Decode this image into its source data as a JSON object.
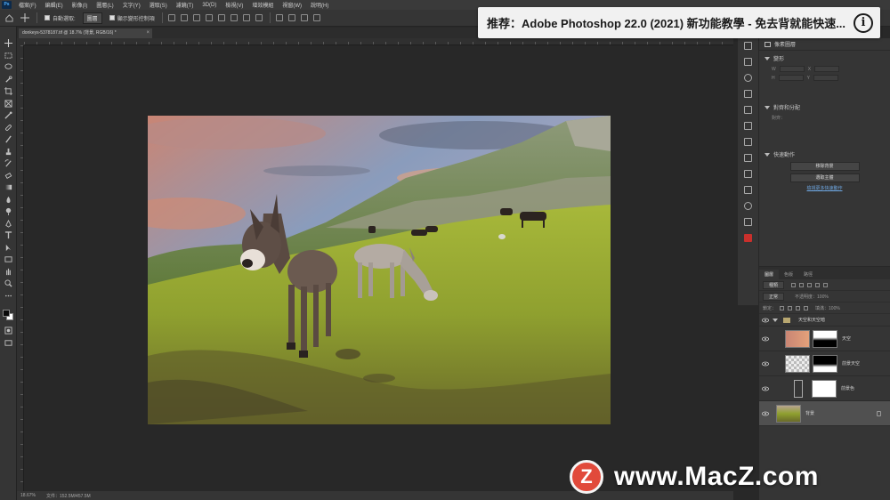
{
  "app": {
    "logo_text": "Ps",
    "menu": [
      "檔案(F)",
      "編輯(E)",
      "影像(I)",
      "圖層(L)",
      "文字(Y)",
      "選取(S)",
      "濾鏡(T)",
      "3D(D)",
      "檢視(V)",
      "增效模組",
      "視窗(W)",
      "說明(H)"
    ]
  },
  "options_bar": {
    "auto_select_label": "自動選取:",
    "auto_select_target": "圖層",
    "show_transform_label": "顯示變形控制項"
  },
  "banner": {
    "text": "推荐：Adobe Photoshop 22.0 (2021) 新功能教學 - 免去背就能快速...",
    "info_icon": "i"
  },
  "document": {
    "tab_title": "donkeys-5378187.tif @ 18.7% (背景, RGB/16) *",
    "tab_close": "×"
  },
  "status_bar": {
    "zoom": "18.67%",
    "doc_info": "文件：152.5M/457.5M"
  },
  "properties": {
    "title": "屬性",
    "header_label": "像素圖層",
    "transform_title": "變形",
    "w_label": "W",
    "h_label": "H",
    "x_label": "X",
    "y_label": "Y",
    "align_title": "對齊和分配",
    "align_sub": "對齊：",
    "quick_actions_title": "快速動作",
    "btn_remove_bg": "移除背景",
    "btn_select_subject": "選取主體",
    "link_more": "檢視更多快速動作"
  },
  "layers": {
    "tabs": [
      "圖層",
      "色版",
      "路徑"
    ],
    "kind_label": "種類",
    "mode_label": "正常",
    "opacity_label": "不透明度：100%",
    "lock_label": "鎖定：",
    "fill_label": "填滿：100%",
    "items": [
      {
        "name": "天空和天空暗",
        "type": "group"
      },
      {
        "name": "天空",
        "type": "layer"
      },
      {
        "name": "前景天空",
        "type": "layer"
      },
      {
        "name": "前景色",
        "type": "layer"
      },
      {
        "name": "背景",
        "type": "background"
      }
    ]
  },
  "watermark": {
    "logo_letter": "Z",
    "text": "www.MacZ.com"
  },
  "colors": {
    "accent_blue": "#4fb0ff",
    "watermark_red": "#e14a3b",
    "panel_bg": "#353535",
    "canvas_bg": "#282828"
  }
}
